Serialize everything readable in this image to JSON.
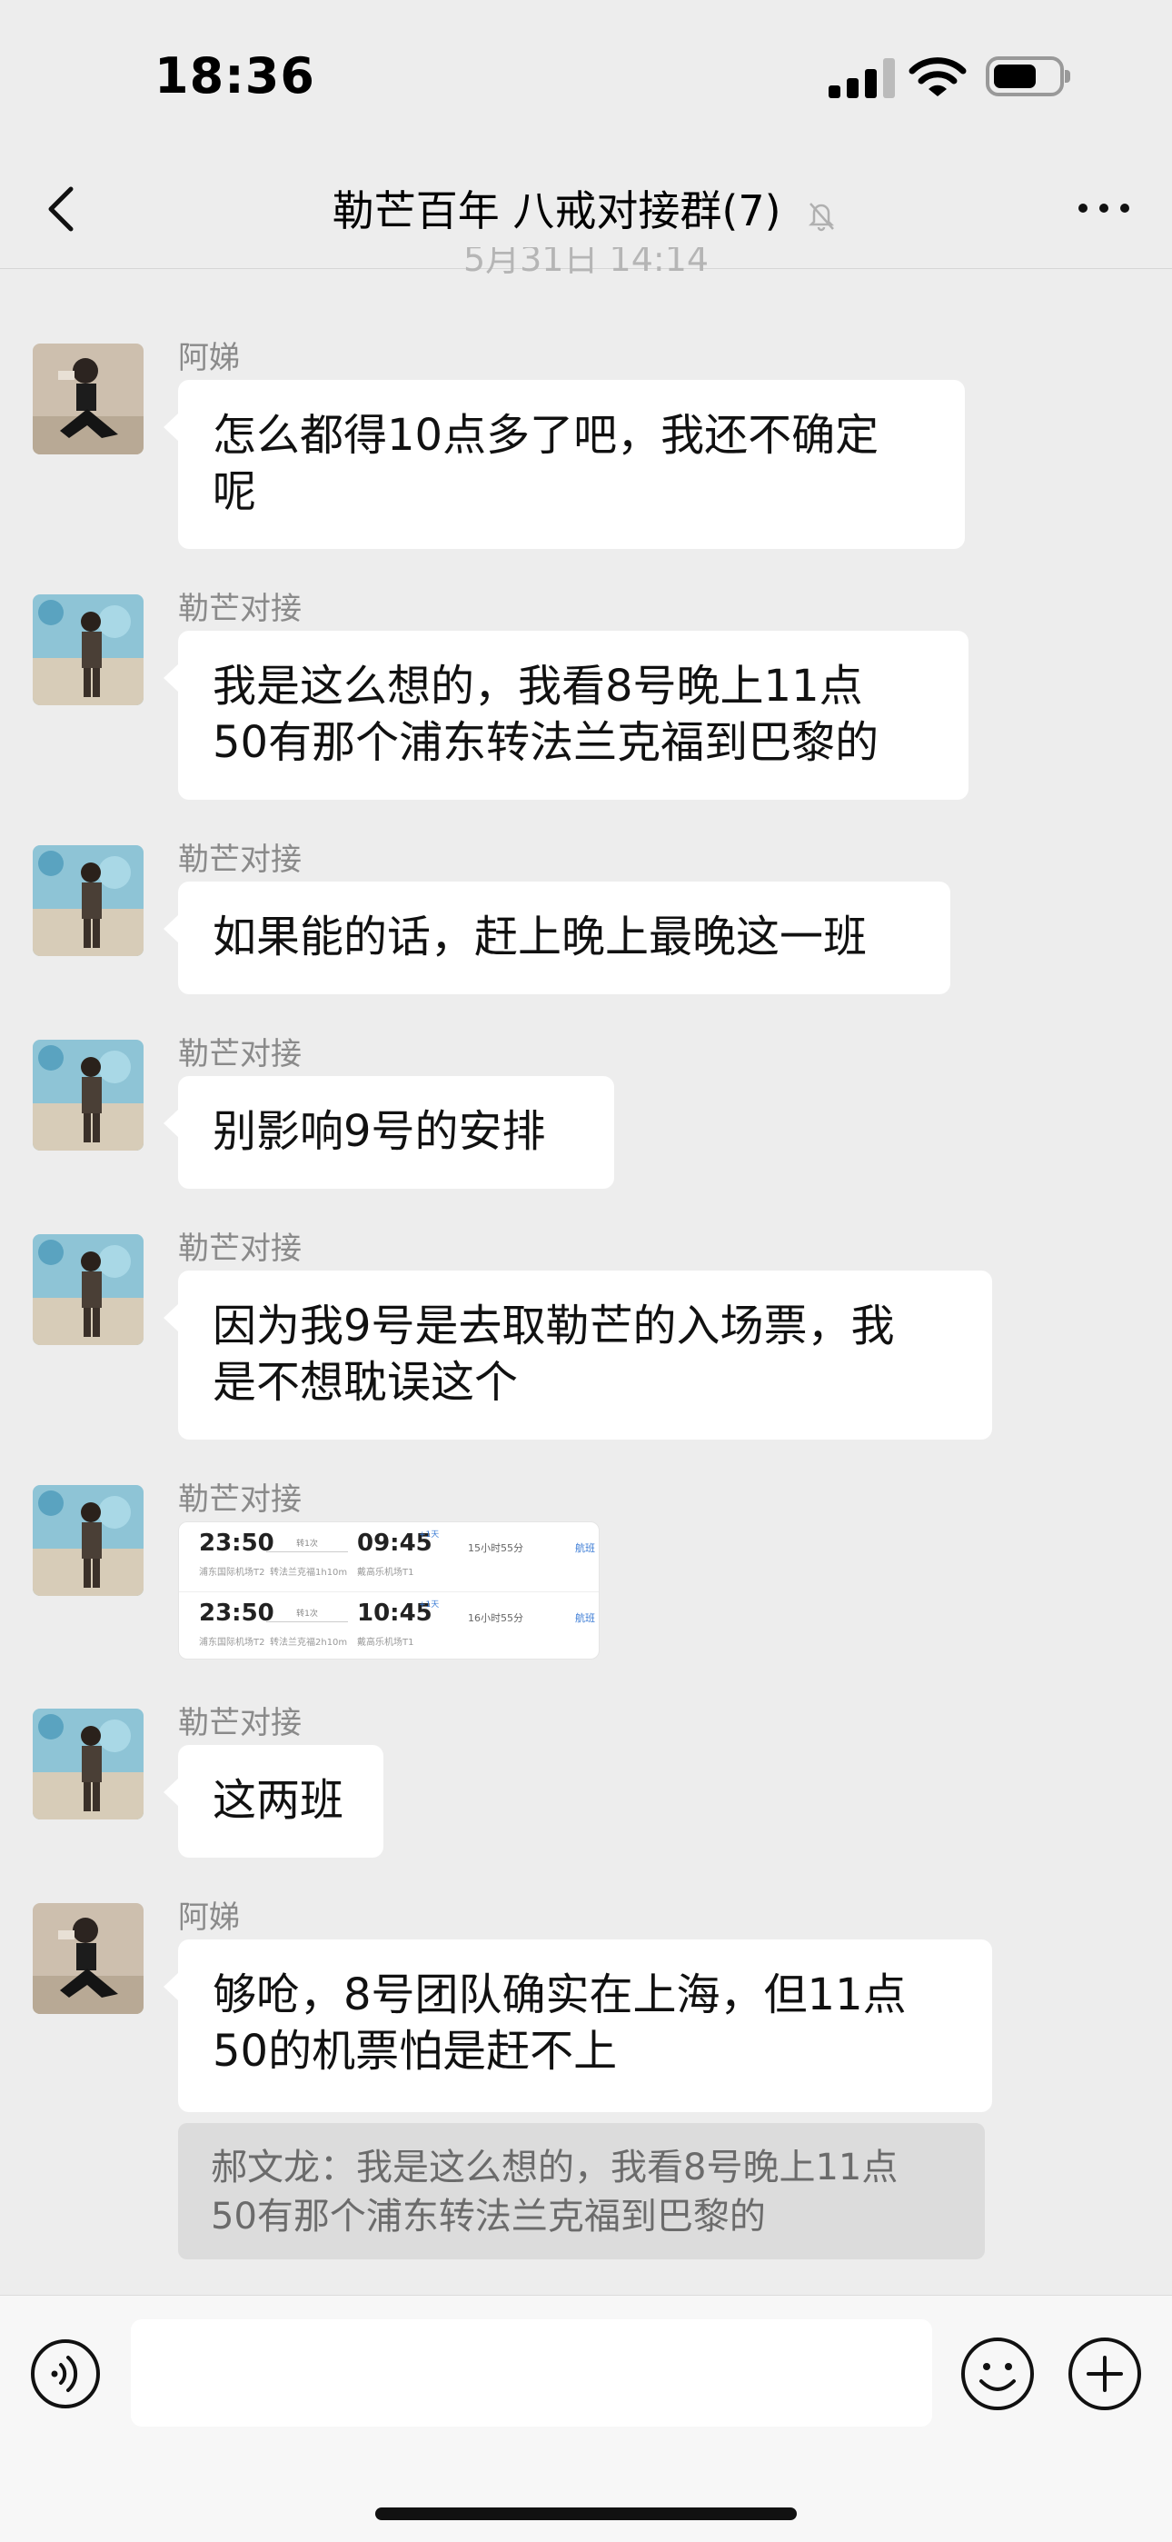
{
  "status_bar": {
    "time": "18:36"
  },
  "nav": {
    "title": "勒芒百年 八戒对接群(7)"
  },
  "timestamp": "5月31日 14:14",
  "messages": [
    {
      "sender": "阿娣",
      "lines": [
        "怎么都得10点多了吧，我还不确定",
        "呢"
      ]
    },
    {
      "sender": "勒芒对接",
      "lines": [
        "我是这么想的，我看8号晚上11点",
        "50有那个浦东转法兰克福到巴黎的"
      ]
    },
    {
      "sender": "勒芒对接",
      "lines": [
        "如果能的话，赶上晚上最晚这一班"
      ]
    },
    {
      "sender": "勒芒对接",
      "lines": [
        "别影响9号的安排"
      ]
    },
    {
      "sender": "勒芒对接",
      "lines": [
        "因为我9号是去取勒芒的入场票，我",
        "是不想耽误这个"
      ]
    },
    {
      "sender": "勒芒对接"
    },
    {
      "sender": "勒芒对接",
      "lines": [
        "这两班"
      ]
    },
    {
      "sender": "阿娣",
      "lines": [
        "够呛，8号团队确实在上海，但11点",
        "50的机票怕是赶不上"
      ]
    }
  ],
  "flights": [
    {
      "dep": "23:50",
      "dep_airport": "浦东国际机场T2",
      "stops": "转1次",
      "via": "转法兰克福1h10m",
      "arr": "09:45",
      "arr_airport": "戴高乐机场T1",
      "plus": "+1天",
      "duration": "15小时55分",
      "link": "航班"
    },
    {
      "dep": "23:50",
      "dep_airport": "浦东国际机场T2",
      "stops": "转1次",
      "via": "转法兰克福2h10m",
      "arr": "10:45",
      "arr_airport": "戴高乐机场T1",
      "plus": "+1天",
      "duration": "16小时55分",
      "link": "航班"
    }
  ],
  "quote": {
    "lines": [
      "郝文龙：我是这么想的，我看8号晚上11点",
      "50有那个浦东转法兰克福到巴黎的"
    ]
  },
  "input": {
    "value": ""
  }
}
